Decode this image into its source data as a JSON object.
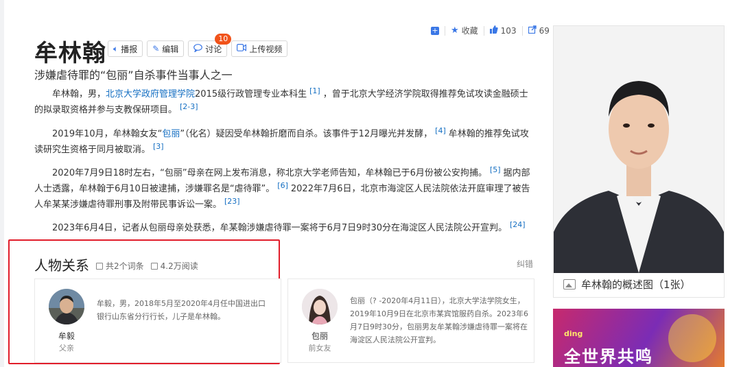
{
  "entry": {
    "title": "牟林翰",
    "subtitle": "涉嫌虐待罪的“包丽”自杀事件当事人之一"
  },
  "toolbar": {
    "collect_label": "收藏",
    "like_count": "103",
    "share_count": "69"
  },
  "actions": {
    "play": "播报",
    "edit": "编辑",
    "discuss": "讨论",
    "discuss_badge": "10",
    "upload": "上传视频"
  },
  "paragraphs": {
    "p1": {
      "t1": "牟林翰，男，",
      "link": "北京大学政府管理学院",
      "t2": "2015级行政管理专业本科生",
      "ref1": "[1]",
      "t3": "，曾于北京大学经济学院取得推荐免试攻读金融硕士的拟录取资格并参与支教保研项目。",
      "ref2": "[2-3]"
    },
    "p2": {
      "t1": "2019年10月，牟林翰女友“",
      "link": "包丽",
      "t2": "”（化名）疑因受牟林翰折磨而自杀。该事件于12月曝光并发酵，",
      "ref1": "[4]",
      "t3": "牟林翰的推荐免试攻读研究生资格于同月被取消。",
      "ref2": "[3]"
    },
    "p3": {
      "t1": "2020年7月9日18时左右，“包丽”母亲在网上发布消息，称北京大学老师告知，牟林翰已于6月份被公安拘捕。",
      "ref1": "[5]",
      "t2": "据内部人士透露，牟林翰于6月10日被逮捕，涉嫌罪名是“虐待罪”。",
      "ref2": "[6]",
      "t3": "2022年7月6日，北京市海淀区人民法院依法开庭审理了被告人牟某某涉嫌虐待罪刑事及附带民事诉讼一案。",
      "ref3": "[23]"
    },
    "p4": {
      "t1": "2023年6月4日，记者从包丽母亲处获悉，牟某翰涉嫌虐待罪一案将于6月7日9时30分在海淀区人民法院公开宣判。",
      "ref1": "[24]"
    }
  },
  "photo": {
    "caption": "牟林翰的概述图（1张）"
  },
  "ad": {
    "logo": "ding",
    "text": "全世界共鸣"
  },
  "relations": {
    "title": "人物关系",
    "entry_count": "共2个词条",
    "reads": "4.2万阅读",
    "report": "纠错",
    "cards": [
      {
        "name": "牟毅",
        "role": "父亲",
        "desc": "牟毅，男，2018年5月至2020年4月任中国进出口银行山东省分行行长，儿子是牟林翰。"
      },
      {
        "name": "包丽",
        "role": "前女友",
        "desc": "包丽（? -2020年4月11日），北京大学法学院女生，2019年10月9日在北京市某宾馆服药自杀。2023年6月7日9时30分，包丽男友牟某翰涉嫌虐待罪一案将在海淀区人民法院公开宣判。"
      }
    ]
  },
  "colors": {
    "link": "#136ec2",
    "accent": "#3a77e6",
    "highlight_border": "#e11d2a",
    "badge": "#f1531a"
  }
}
